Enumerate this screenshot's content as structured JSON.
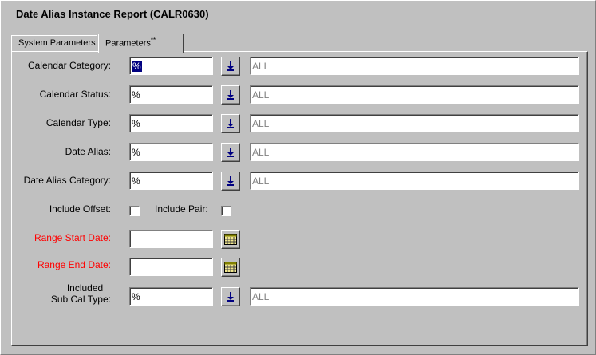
{
  "window": {
    "title": "Date Alias Instance Report (CALR0630)"
  },
  "tabs": [
    {
      "label": "System Parameters",
      "active": false
    },
    {
      "label": "Parameters",
      "marker": "**",
      "active": true
    }
  ],
  "fields": [
    {
      "label": "Calendar Category:",
      "value": "%",
      "description": "ALL"
    },
    {
      "label": "Calendar Status:",
      "value": "%",
      "description": "ALL"
    },
    {
      "label": "Calendar Type:",
      "value": "%",
      "description": "ALL"
    },
    {
      "label": "Date Alias:",
      "value": "%",
      "description": "ALL"
    },
    {
      "label": "Date Alias Category:",
      "value": "%",
      "description": "ALL"
    }
  ],
  "options": {
    "include_offset_label": "Include Offset:",
    "include_offset_checked": false,
    "include_pair_label": "Include Pair:",
    "include_pair_checked": false
  },
  "dates": {
    "range_start_label": "Range Start Date:",
    "range_start_value": "",
    "range_end_label": "Range End Date:",
    "range_end_value": ""
  },
  "sub_cal": {
    "label_line1": "Included",
    "label_line2": "Sub Cal Type:",
    "value": "%",
    "description": "ALL"
  },
  "colors": {
    "required_label": "#ff0000",
    "selection": "#000080",
    "lookup_arrow": "#000080",
    "background": "#c0c0c0"
  },
  "icons": {
    "lookup": "down-arrow-icon",
    "calendar": "calendar-icon"
  }
}
